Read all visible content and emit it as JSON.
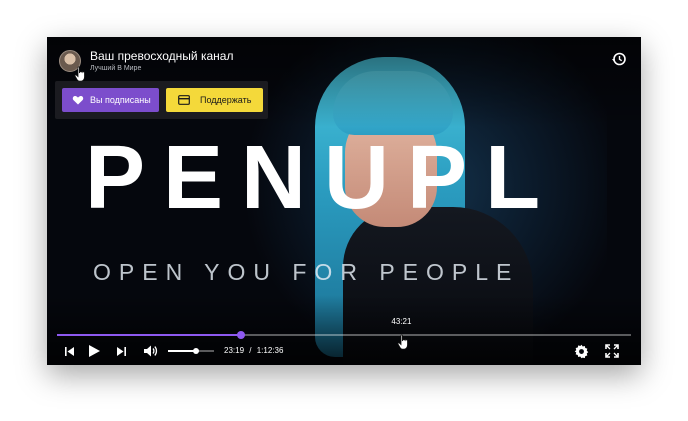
{
  "channel": {
    "name": "Ваш превосходный канал",
    "subtitle": "Лучший В Мире"
  },
  "actions": {
    "subscribed_label": "Вы подписаны",
    "support_label": "Поддержать"
  },
  "video": {
    "logo_text": "PENUPL",
    "tagline": "OPEN YOU FOR PEOPLE"
  },
  "player": {
    "current_time": "23:19",
    "separator": "/",
    "duration": "1:12:36",
    "hover_time": "43:21",
    "progress_fraction": 0.32,
    "hover_fraction": 0.6,
    "volume_fraction": 0.6
  },
  "colors": {
    "accent": "#8e59f0",
    "subscribe_button": "#7c4dcc",
    "support_button": "#f4d93a"
  },
  "icons": {
    "history": "history-icon",
    "heart": "heart-icon",
    "card": "credit-card-icon",
    "prev": "skip-previous-icon",
    "play": "play-icon",
    "next": "skip-next-icon",
    "volume": "volume-icon",
    "settings": "gear-icon",
    "fullscreen": "fullscreen-icon"
  }
}
